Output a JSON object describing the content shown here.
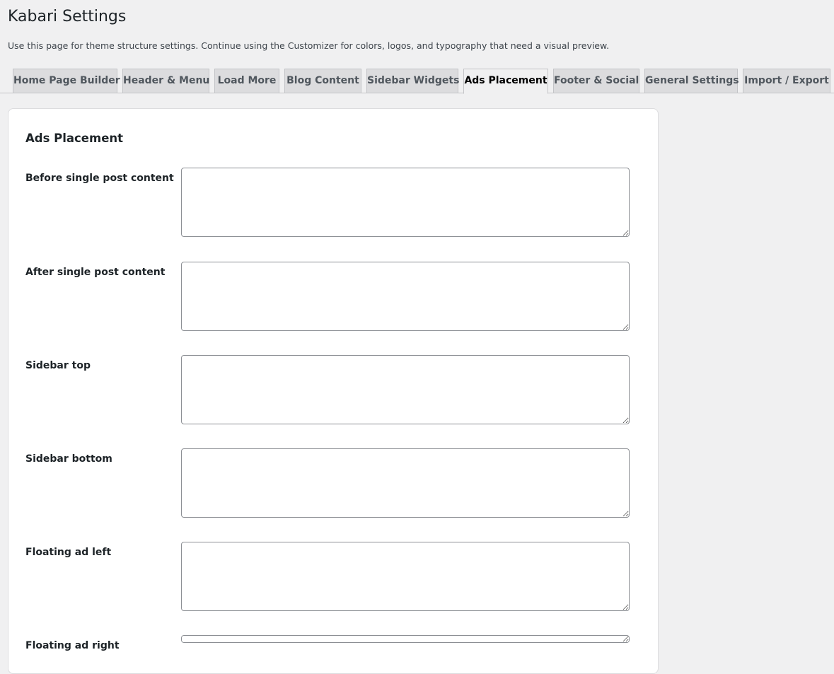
{
  "page": {
    "title": "Kabari Settings",
    "description": "Use this page for theme structure settings. Continue using the Customizer for colors, logos, and typography that need a visual preview."
  },
  "tabs": [
    {
      "label": "Home Page Builder",
      "active": false
    },
    {
      "label": "Header & Menu",
      "active": false
    },
    {
      "label": "Load More",
      "active": false
    },
    {
      "label": "Blog Content",
      "active": false
    },
    {
      "label": "Sidebar Widgets",
      "active": false
    },
    {
      "label": "Ads Placement",
      "active": true
    },
    {
      "label": "Footer & Social",
      "active": false
    },
    {
      "label": "General Settings",
      "active": false
    },
    {
      "label": "Import / Export",
      "active": false
    }
  ],
  "section": {
    "title": "Ads Placement",
    "fields": [
      {
        "label": "Before single post content",
        "value": ""
      },
      {
        "label": "After single post content",
        "value": ""
      },
      {
        "label": "Sidebar top",
        "value": ""
      },
      {
        "label": "Sidebar bottom",
        "value": ""
      },
      {
        "label": "Floating ad left",
        "value": ""
      },
      {
        "label": "Floating ad right",
        "value": ""
      }
    ]
  }
}
